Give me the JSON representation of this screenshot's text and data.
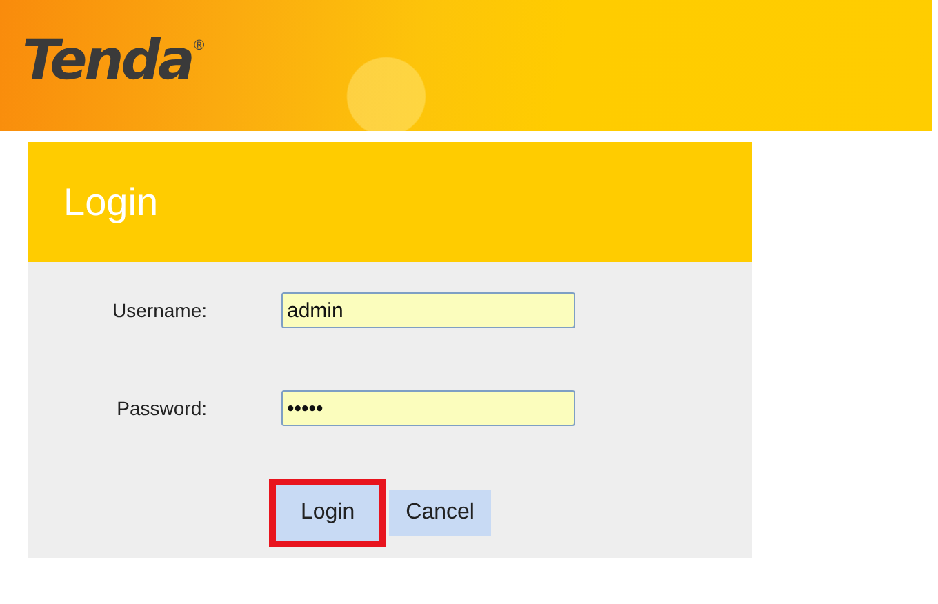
{
  "header": {
    "logo": "Tenda",
    "registered_mark": "®"
  },
  "login_panel": {
    "title": "Login",
    "fields": [
      {
        "label": "Username:",
        "value": "admin"
      },
      {
        "label": "Password:",
        "value": "•••••"
      }
    ],
    "buttons": [
      {
        "label": "Login",
        "highlighted": true
      },
      {
        "label": "Cancel",
        "highlighted": false
      }
    ]
  }
}
